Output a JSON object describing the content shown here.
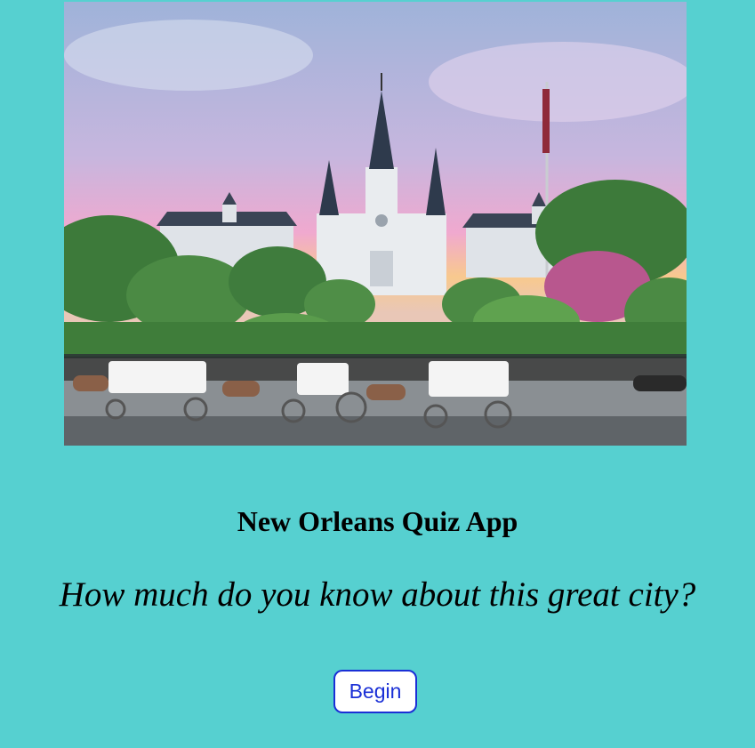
{
  "hero_image": {
    "alt": "St. Louis Cathedral and Jackson Square with horse-drawn carriages at sunset",
    "colors": {
      "sky_top": "#a9b8dc",
      "sky_mid": "#d9a6cf",
      "sky_glow": "#f7c98a",
      "foliage": "#3d7a3a",
      "cathedral": "#e9ecef",
      "roof": "#3a4455",
      "street": "#5f6468"
    }
  },
  "header": {
    "title": "New Orleans Quiz App",
    "subtitle": "How much do you know about this great city?"
  },
  "actions": {
    "begin_label": "Begin"
  },
  "theme": {
    "background": "#56d0d0",
    "button_accent": "#1a2fd6"
  }
}
